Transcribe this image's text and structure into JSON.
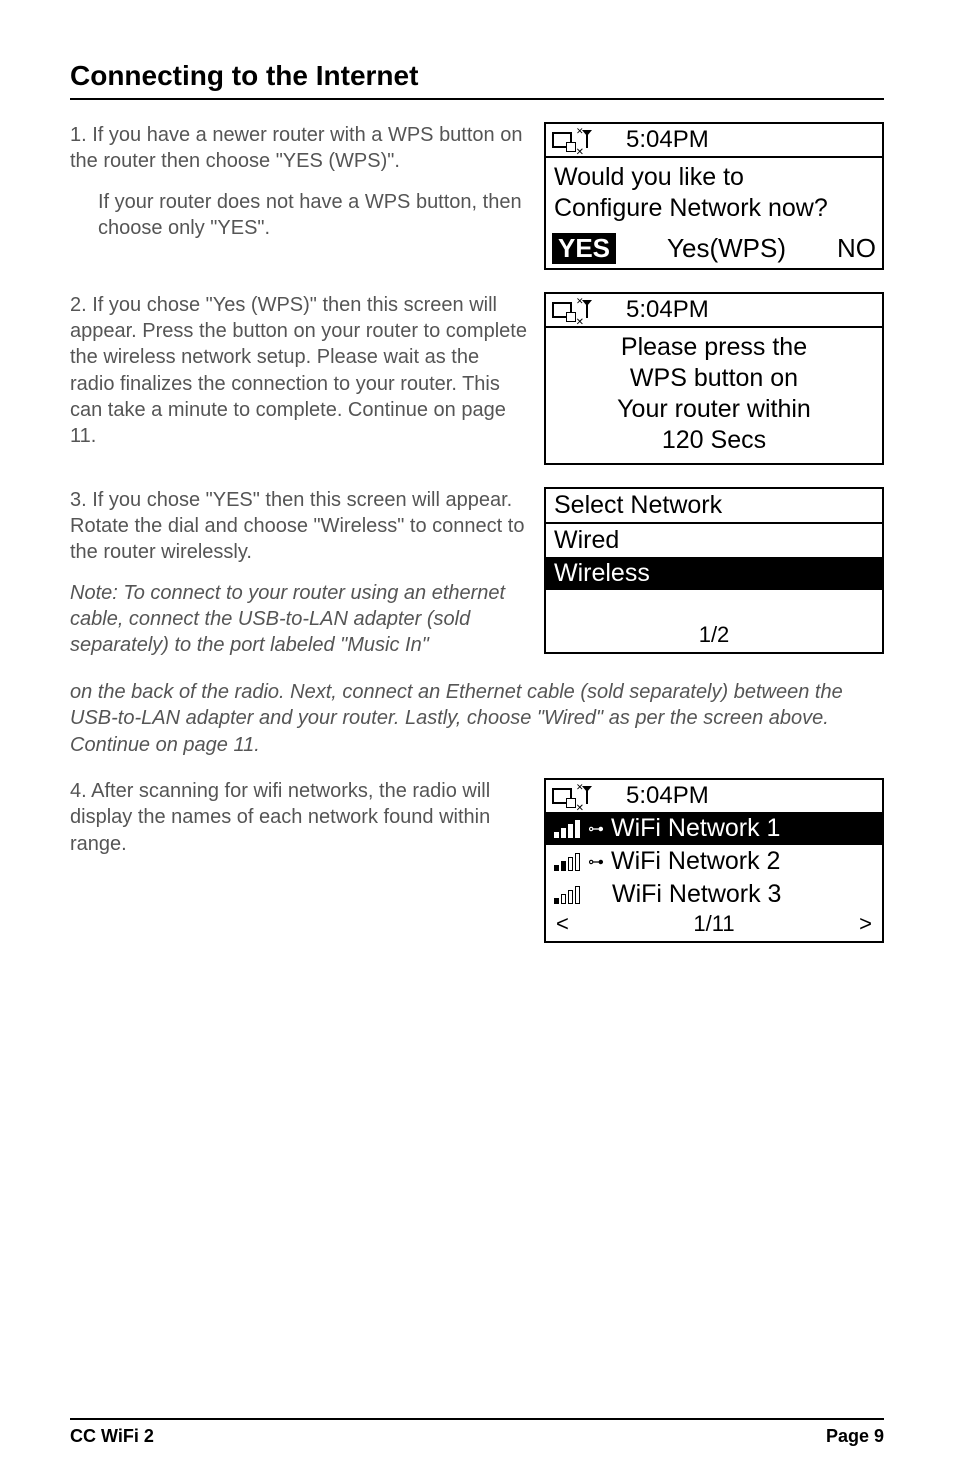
{
  "heading": "Connecting to the Internet",
  "step1": {
    "para1": "1. If you have a newer router with a WPS button on the router then choose \"YES (WPS)\".",
    "para2": "If your router does not have a WPS button, then choose only \"YES\"."
  },
  "step2": {
    "para1": "2. If you chose \"Yes (WPS)\" then this screen will appear. Press the button on your router to complete the wireless network setup. Please wait as the radio finalizes the connection to your router. This can take a minute to complete. Continue on page 11."
  },
  "step3": {
    "para1": "3. If you chose \"YES\" then this screen will appear. Rotate the dial and choose \"Wireless\" to connect to the router wirelessly."
  },
  "note_left": "Note: To connect to your router using an ethernet cable, connect the USB-to-LAN adapter (sold separately) to the port labeled \"Music In\"",
  "note_full": "on the back of the radio. Next, connect an Ethernet cable (sold separately) between the USB-to-LAN adapter and your router. Lastly, choose \"Wired\" as per the screen above. Continue on page 11.",
  "step4": {
    "para1": "4. After scanning for wifi networks, the radio will display the names of each network found within range."
  },
  "screen1": {
    "time": "5:04PM",
    "line1": "Would you like to",
    "line2": "Configure Network now?",
    "opt_yes": "YES",
    "opt_wps": "Yes(WPS)",
    "opt_no": "NO"
  },
  "screen2": {
    "time": "5:04PM",
    "l1": "Please press the",
    "l2": "WPS button on",
    "l3": "Your router within",
    "l4": "120 Secs"
  },
  "screen3": {
    "title": "Select Network",
    "wired": "Wired",
    "wireless": "Wireless",
    "pager": "1/2"
  },
  "screen4": {
    "time": "5:04PM",
    "row1": "WiFi Network 1",
    "row2": "WiFi Network 2",
    "row3": "WiFi Network 3",
    "pager": "1/11",
    "left": "<",
    "right": ">"
  },
  "footer": {
    "left": "CC WiFi 2",
    "right": "Page 9"
  }
}
